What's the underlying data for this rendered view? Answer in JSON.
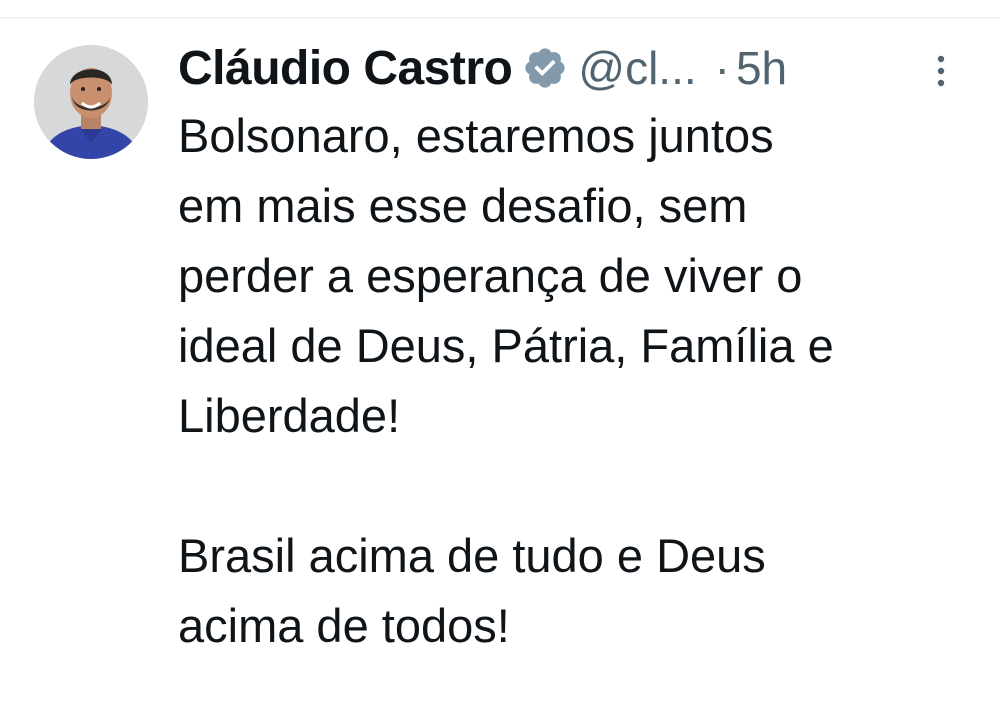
{
  "tweet": {
    "author": {
      "display_name": "Cláudio Castro",
      "handle": "@cl...",
      "verified_icon": "verified-badge-icon",
      "avatar_icon": "avatar"
    },
    "separator": "·",
    "timestamp": "5h",
    "more_icon": "more-vertical-icon",
    "text": "Bolsonaro, estaremos juntos\nem mais esse desafio, sem\nperder a esperança de viver o\nideal de Deus, Pátria, Família e\nLiberdade!\n\nBrasil acima de tudo e Deus\nacima de todos!"
  },
  "colors": {
    "text_primary": "#0f1419",
    "text_secondary": "#536471",
    "verified_badge": "#829aab",
    "divider": "#eff3f4"
  }
}
